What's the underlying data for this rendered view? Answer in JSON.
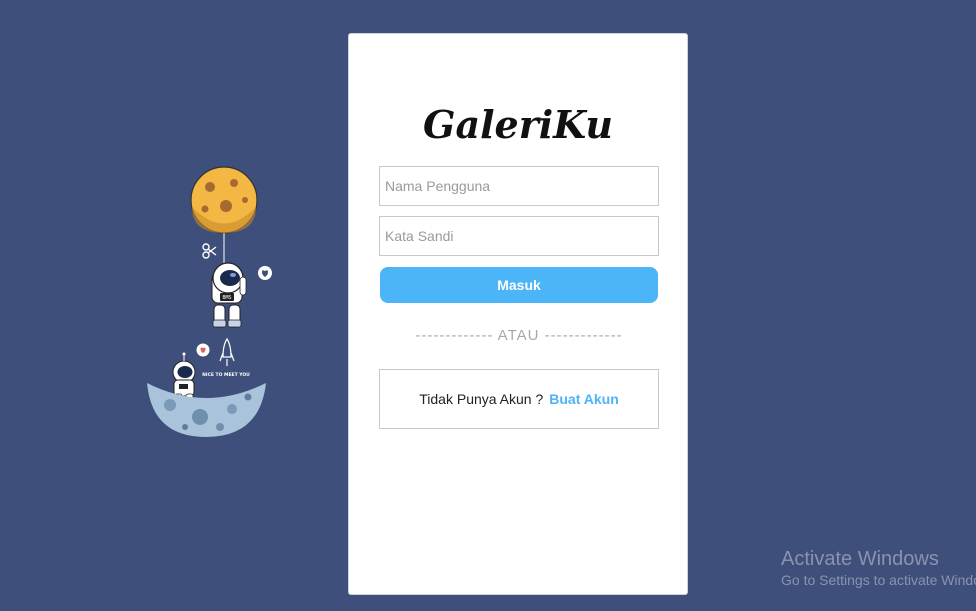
{
  "app": {
    "logo_text": "GaleriKu"
  },
  "illustration": {
    "caption": "NICE TO MEET YOU",
    "badge_text": "BMS"
  },
  "login_form": {
    "username_placeholder": "Nama Pengguna",
    "username_value": "",
    "password_placeholder": "Kata Sandi",
    "password_value": "",
    "submit_label": "Masuk",
    "divider_text": "------------- ATAU -------------"
  },
  "signup": {
    "prompt": "Tidak Punya Akun ?",
    "link_label": "Buat Akun"
  },
  "os_watermark": {
    "title": "Activate Windows",
    "subtitle": "Go to Settings to activate Windows."
  },
  "colors": {
    "background": "#3f4f7c",
    "accent": "#4bb5f7",
    "card": "#ffffff"
  }
}
